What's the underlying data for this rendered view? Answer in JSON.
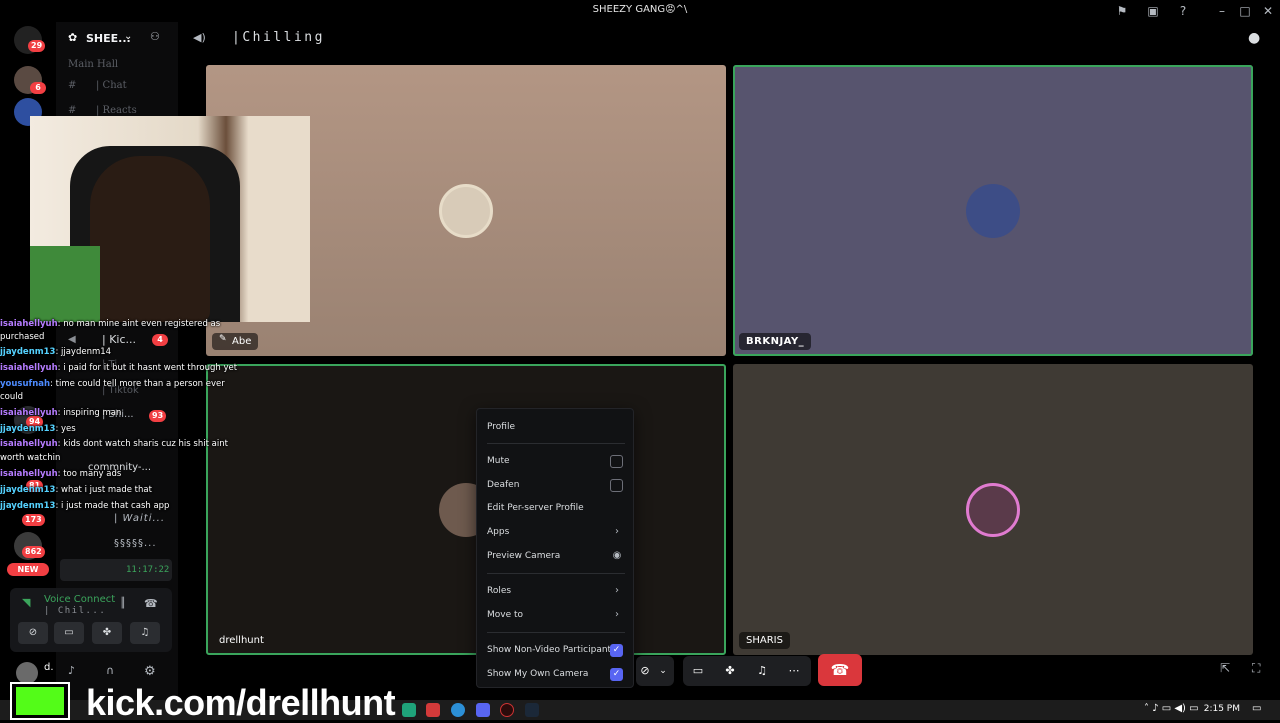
{
  "window": {
    "title": "SHEEZY GANG😡^\\"
  },
  "rail": {
    "badges": [
      "29",
      "6"
    ]
  },
  "sidebar": {
    "server_name": "SHEE...",
    "category": "Main Hall",
    "channels": [
      "| Chat",
      "| Reacts"
    ],
    "voice_channels": [
      {
        "label": "| Kic...",
        "badge": "4"
      },
      {
        "label": "| Ti...",
        "badge": ""
      },
      {
        "label": "| Tiktok",
        "badge": ""
      },
      {
        "label": "| Shi...",
        "badge": "93"
      },
      {
        "label": "commnity-...",
        "badge": ""
      },
      {
        "label": "| Waiti...",
        "badge": ""
      },
      {
        "label": "§§§§§...",
        "badge": ""
      }
    ],
    "rail_lower_badges": [
      "94",
      "81",
      "173",
      "862"
    ],
    "new_pill": "NEW",
    "voice_time": "11:17:22",
    "user_short": "d."
  },
  "header": {
    "channel_title": "|Chilling"
  },
  "participants": [
    {
      "name": "Abe",
      "bg": "#a48a78"
    },
    {
      "name": "BRKNJAY_",
      "bg": "#57546e"
    },
    {
      "name": "drellhunt",
      "bg": "#1a1714"
    },
    {
      "name": "SHARIS",
      "bg": "#3f3a34"
    }
  ],
  "chat": [
    {
      "user": "isaiahellyuh",
      "msg": ": no man mine aint even registered as",
      "cont": "purchased",
      "color": "#b57cff"
    },
    {
      "user": "jjaydenm13",
      "msg": ": jjaydenm14",
      "cont": "",
      "color": "#55d2ff"
    },
    {
      "user": "isaiahellyuh",
      "msg": ": i paid for it but it hasnt went through yet",
      "cont": "",
      "color": "#b57cff"
    },
    {
      "user": "yousufnah",
      "msg": ": time could tell more than a person ever",
      "cont": "could",
      "color": "#4d8bff"
    },
    {
      "user": "isaiahellyuh",
      "msg": ": inspiring man",
      "cont": "",
      "color": "#b57cff"
    },
    {
      "user": "jjaydenm13",
      "msg": ": yes",
      "cont": "",
      "color": "#55d2ff"
    },
    {
      "user": "isaiahellyuh",
      "msg": ": kids dont watch sharis cuz his shit aint",
      "cont": "worth watchin",
      "color": "#b57cff"
    },
    {
      "user": "isaiahellyuh",
      "msg": ": too many ads",
      "cont": "",
      "color": "#b57cff"
    },
    {
      "user": "jjaydenm13",
      "msg": ": what i just made that",
      "cont": "",
      "color": "#55d2ff"
    },
    {
      "user": "jjaydenm13",
      "msg": ": i just made that cash app",
      "cont": "",
      "color": "#55d2ff"
    }
  ],
  "voice_panel": {
    "status": "Voice Connect",
    "channel": "| Chil..."
  },
  "context_menu": {
    "profile": "Profile",
    "mute": "Mute",
    "deafen": "Deafen",
    "edit_profile": "Edit Per-server Profile",
    "apps": "Apps",
    "preview_camera": "Preview Camera",
    "roles": "Roles",
    "move_to": "Move to",
    "show_non_video": "Show Non-Video Participants",
    "show_own_camera": "Show My Own Camera",
    "mute_checked": false,
    "deafen_checked": false,
    "show_non_video_checked": true,
    "show_own_camera_checked": true
  },
  "overlay": {
    "kick_url": "kick.com/drellhunt"
  },
  "taskbar": {
    "time": "2:15 PM"
  },
  "colors": {
    "speaking_outline": "#3aa55c",
    "hangup": "#da373c",
    "kick_green": "#53fc18",
    "checkbox_on": "#5865f2"
  }
}
